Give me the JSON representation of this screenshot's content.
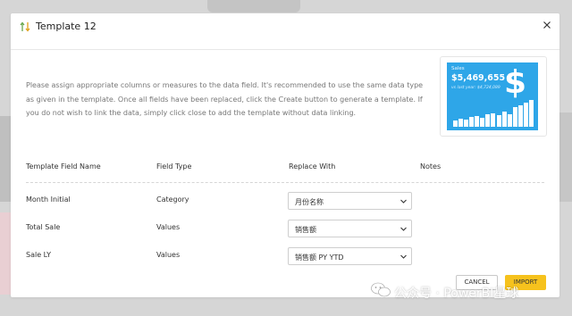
{
  "dialog": {
    "title": "Template 12",
    "close_symbol": "×",
    "description": "Please assign appropriate columns or measures to the data field. It's recommended to use the same data type as given in the template. Once all fields have been replaced, click the Create button to generate a template. If you do not wish to link the data, simply click close to add the template without data linking."
  },
  "preview": {
    "label": "Sales",
    "value": "$5,469,655",
    "subtext": "vs last year: $4,724,089",
    "symbol": "$",
    "bars": [
      0.22,
      0.3,
      0.26,
      0.35,
      0.4,
      0.34,
      0.45,
      0.5,
      0.42,
      0.58,
      0.48,
      0.72,
      0.8,
      0.9,
      1.0
    ]
  },
  "table": {
    "headers": [
      "Template Field Name",
      "Field Type",
      "Replace With",
      "Notes"
    ],
    "rows": [
      {
        "field": "Month Initial",
        "type": "Category",
        "replace": "月份名称"
      },
      {
        "field": "Total Sale",
        "type": "Values",
        "replace": "销售额"
      },
      {
        "field": "Sale LY",
        "type": "Values",
        "replace": "销售额 PY YTD"
      }
    ]
  },
  "buttons": {
    "cancel": "CANCEL",
    "import": "IMPORT"
  },
  "watermark": {
    "text": "公众号 · PowerBI星球"
  },
  "colors": {
    "accent": "#f6c21d",
    "preview_bg": "#2ea6e8"
  }
}
